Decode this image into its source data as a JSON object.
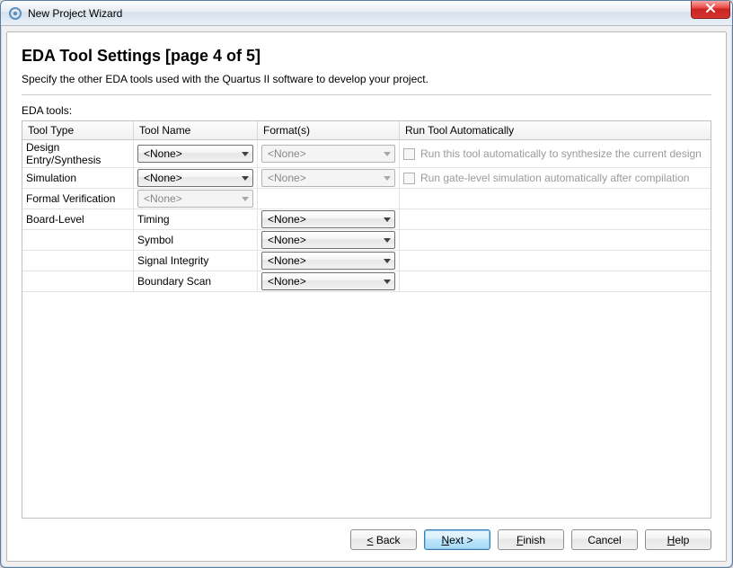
{
  "window": {
    "title": "New Project Wizard"
  },
  "page": {
    "heading": "EDA Tool Settings [page 4 of 5]",
    "subtitle": "Specify the other EDA tools used with the Quartus II software to develop your project.",
    "section_label": "EDA tools:"
  },
  "table": {
    "headers": {
      "tool_type": "Tool Type",
      "tool_name": "Tool Name",
      "formats": "Format(s)",
      "run_auto": "Run Tool Automatically"
    },
    "rows": {
      "r0": {
        "type": "Design Entry/Synthesis",
        "name": "<None>",
        "format": "<None>",
        "auto_label": "Run this tool automatically to synthesize the current design"
      },
      "r1": {
        "type": "Simulation",
        "name": "<None>",
        "format": "<None>",
        "auto_label": "Run gate-level simulation automatically after compilation"
      },
      "r2": {
        "type": "Formal Verification",
        "name": "<None>"
      },
      "r3": {
        "type": "Board-Level",
        "sub0_label": "Timing",
        "sub0_format": "<None>",
        "sub1_label": "Symbol",
        "sub1_format": "<None>",
        "sub2_label": "Signal Integrity",
        "sub2_format": "<None>",
        "sub3_label": "Boundary Scan",
        "sub3_format": "<None>"
      }
    }
  },
  "buttons": {
    "back": "< Back",
    "next": "Next >",
    "finish": "Finish",
    "cancel": "Cancel",
    "help": "Help"
  }
}
